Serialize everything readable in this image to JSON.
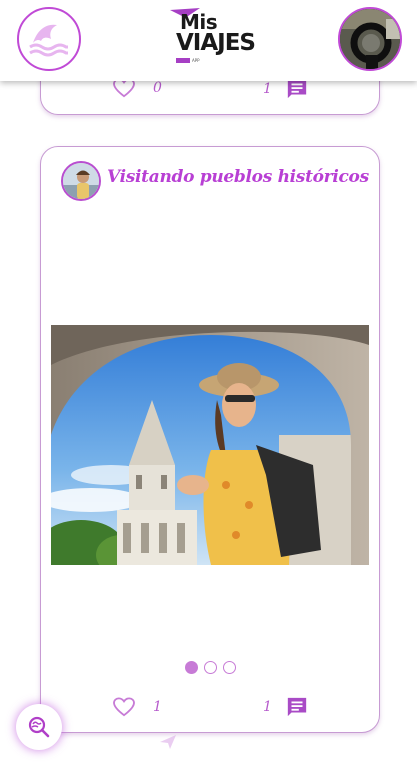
{
  "header": {
    "menu_icon": "waves-icon",
    "logo": {
      "line1": "Mis",
      "line2": "VIAJES",
      "line3": "APP"
    },
    "profile_icon": "user-avatar"
  },
  "posts": [
    {
      "likes": "0",
      "comments": "1"
    },
    {
      "title": "Visitando pueblos históricos",
      "image_icon": "travel-photo",
      "carousel": {
        "total": 3,
        "active": 0
      },
      "likes": "1",
      "comments": "1"
    }
  ],
  "fab": {
    "icon": "search-location-icon"
  },
  "colors": {
    "accent": "#c04ad6",
    "title": "#b83fd4",
    "count": "#b65bcc"
  }
}
